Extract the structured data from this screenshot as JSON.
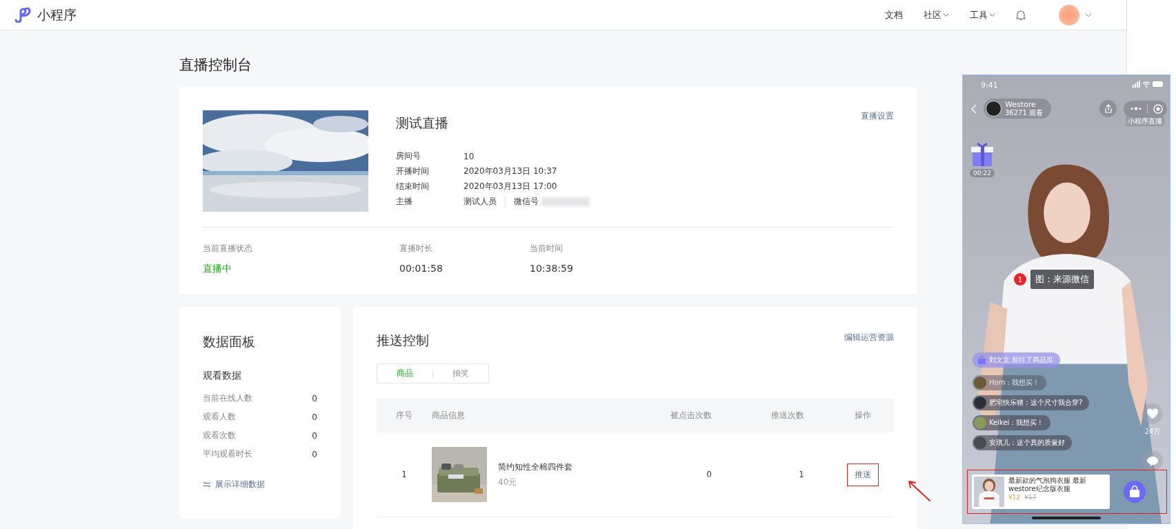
{
  "nav": {
    "logo": "小程序",
    "links": [
      {
        "label": "文档",
        "dropdown": false
      },
      {
        "label": "社区",
        "dropdown": true
      },
      {
        "label": "工具",
        "dropdown": true
      }
    ]
  },
  "page_title": "直播控制台",
  "live": {
    "title": "测试直播",
    "settings_link": "直播设置",
    "fields": [
      {
        "label": "房间号",
        "value": "10"
      },
      {
        "label": "开播时间",
        "value": "2020年03月13日 10:37"
      },
      {
        "label": "结束时间",
        "value": "2020年03月13日 17:00"
      }
    ],
    "anchor": {
      "label": "主播",
      "name": "测试人员",
      "wechat_label": "微信号"
    },
    "stats": [
      {
        "label": "当前直播状态",
        "value": "直播中",
        "kind": "status"
      },
      {
        "label": "直播时长",
        "value": "00:01:58",
        "kind": "plain"
      },
      {
        "label": "当前时间",
        "value": "10:38:59",
        "kind": "plain"
      }
    ]
  },
  "data_panel": {
    "title": "数据面板",
    "section": "观看数据",
    "rows": [
      {
        "label": "当前在线人数",
        "value": "0"
      },
      {
        "label": "观看人数",
        "value": "0"
      },
      {
        "label": "观看次数",
        "value": "0"
      },
      {
        "label": "平均观看时长",
        "value": "0"
      }
    ],
    "detail_link": "展示详细数据"
  },
  "push": {
    "title": "推送控制",
    "edit_link": "编辑运营资源",
    "tabs": [
      {
        "label": "商品",
        "selected": true
      },
      {
        "label": "抽奖",
        "selected": false
      }
    ],
    "columns": [
      "序号",
      "商品信息",
      "被点击次数",
      "推送次数",
      "操作"
    ],
    "rows": [
      {
        "index": "1",
        "name": "简约知性全棉四件套",
        "price": "40元",
        "clicks": "0",
        "pushes": "1",
        "action": "推送",
        "highlighted": true
      }
    ]
  },
  "phone": {
    "time": "9:41",
    "shop": "Westore",
    "viewers": "36271 观看",
    "watermark": "小程序直播",
    "gift_timer": "00:22",
    "annotation": {
      "number": "1",
      "text": "图：来源微信"
    },
    "notice": "刘文文 前往了商品页",
    "comments": [
      {
        "text": "Hom：我想买！",
        "faded": true
      },
      {
        "text": "肥宅快乐猪：这个尺寸我合穿?",
        "faded": false
      },
      {
        "text": "Keikei：我想买！",
        "faded": false
      },
      {
        "text": "安琪儿：这个真的质量好",
        "faded": false
      }
    ],
    "likes": "24万",
    "product": {
      "title": "最新款的气泡狗衣服 最新westore纪念版衣服",
      "price": "¥12",
      "original_price": "¥17",
      "highlighted": true
    }
  }
}
